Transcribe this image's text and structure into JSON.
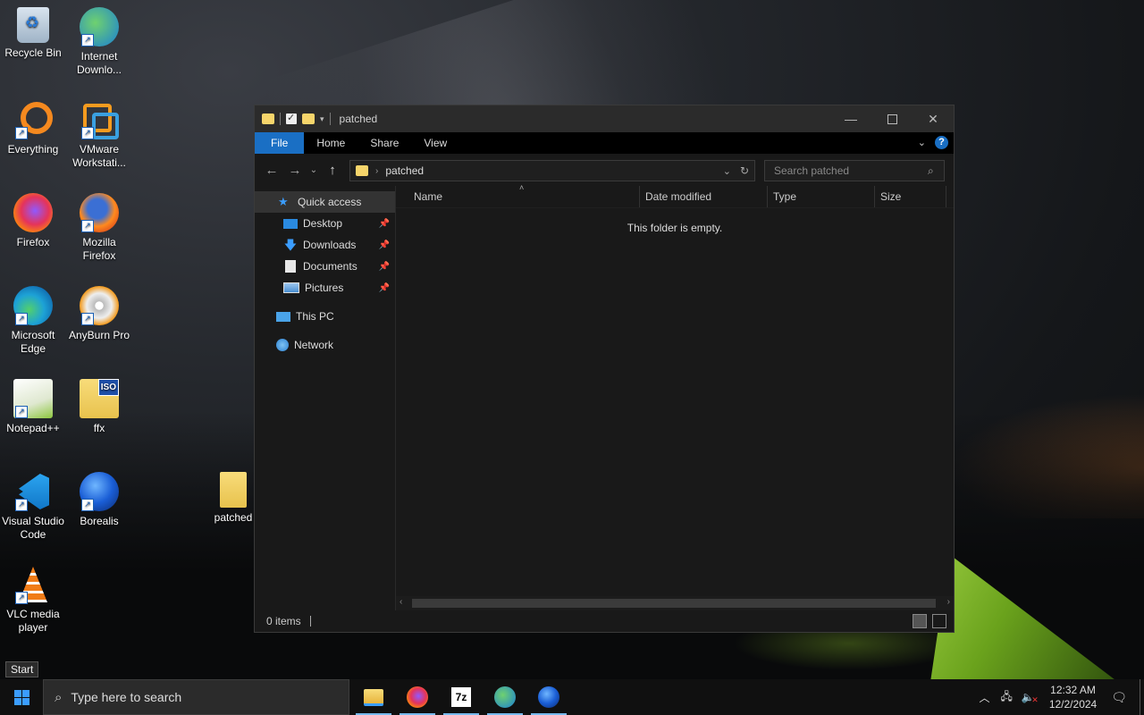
{
  "desktop": {
    "icons": [
      {
        "label": "Recycle Bin"
      },
      {
        "label": "Internet Downlo..."
      },
      {
        "label": "Everything"
      },
      {
        "label": "VMware Workstati..."
      },
      {
        "label": "Firefox"
      },
      {
        "label": "Mozilla Firefox"
      },
      {
        "label": "Microsoft Edge"
      },
      {
        "label": "AnyBurn Pro"
      },
      {
        "label": "Notepad++"
      },
      {
        "label": "ffx"
      },
      {
        "label": "Visual Studio Code"
      },
      {
        "label": "Borealis"
      },
      {
        "label": "patched"
      },
      {
        "label": "VLC media player"
      }
    ]
  },
  "explorer": {
    "title": "patched",
    "ribbon_tabs": [
      "File",
      "Home",
      "Share",
      "View"
    ],
    "address_path": "patched",
    "search_placeholder": "Search patched",
    "nav": {
      "quick_access": "Quick access",
      "desktop": "Desktop",
      "downloads": "Downloads",
      "documents": "Documents",
      "pictures": "Pictures",
      "this_pc": "This PC",
      "network": "Network"
    },
    "columns": [
      "Name",
      "Date modified",
      "Type",
      "Size"
    ],
    "empty_message": "This folder is empty.",
    "status": "0 items"
  },
  "taskbar": {
    "search_placeholder": "Type here to search",
    "tooltip": "Start",
    "time": "12:32 AM",
    "date": "12/2/2024"
  },
  "colors": {
    "accent": "#1a6fc4",
    "window_bg": "#191919",
    "taskbar_bg": "#101010"
  }
}
